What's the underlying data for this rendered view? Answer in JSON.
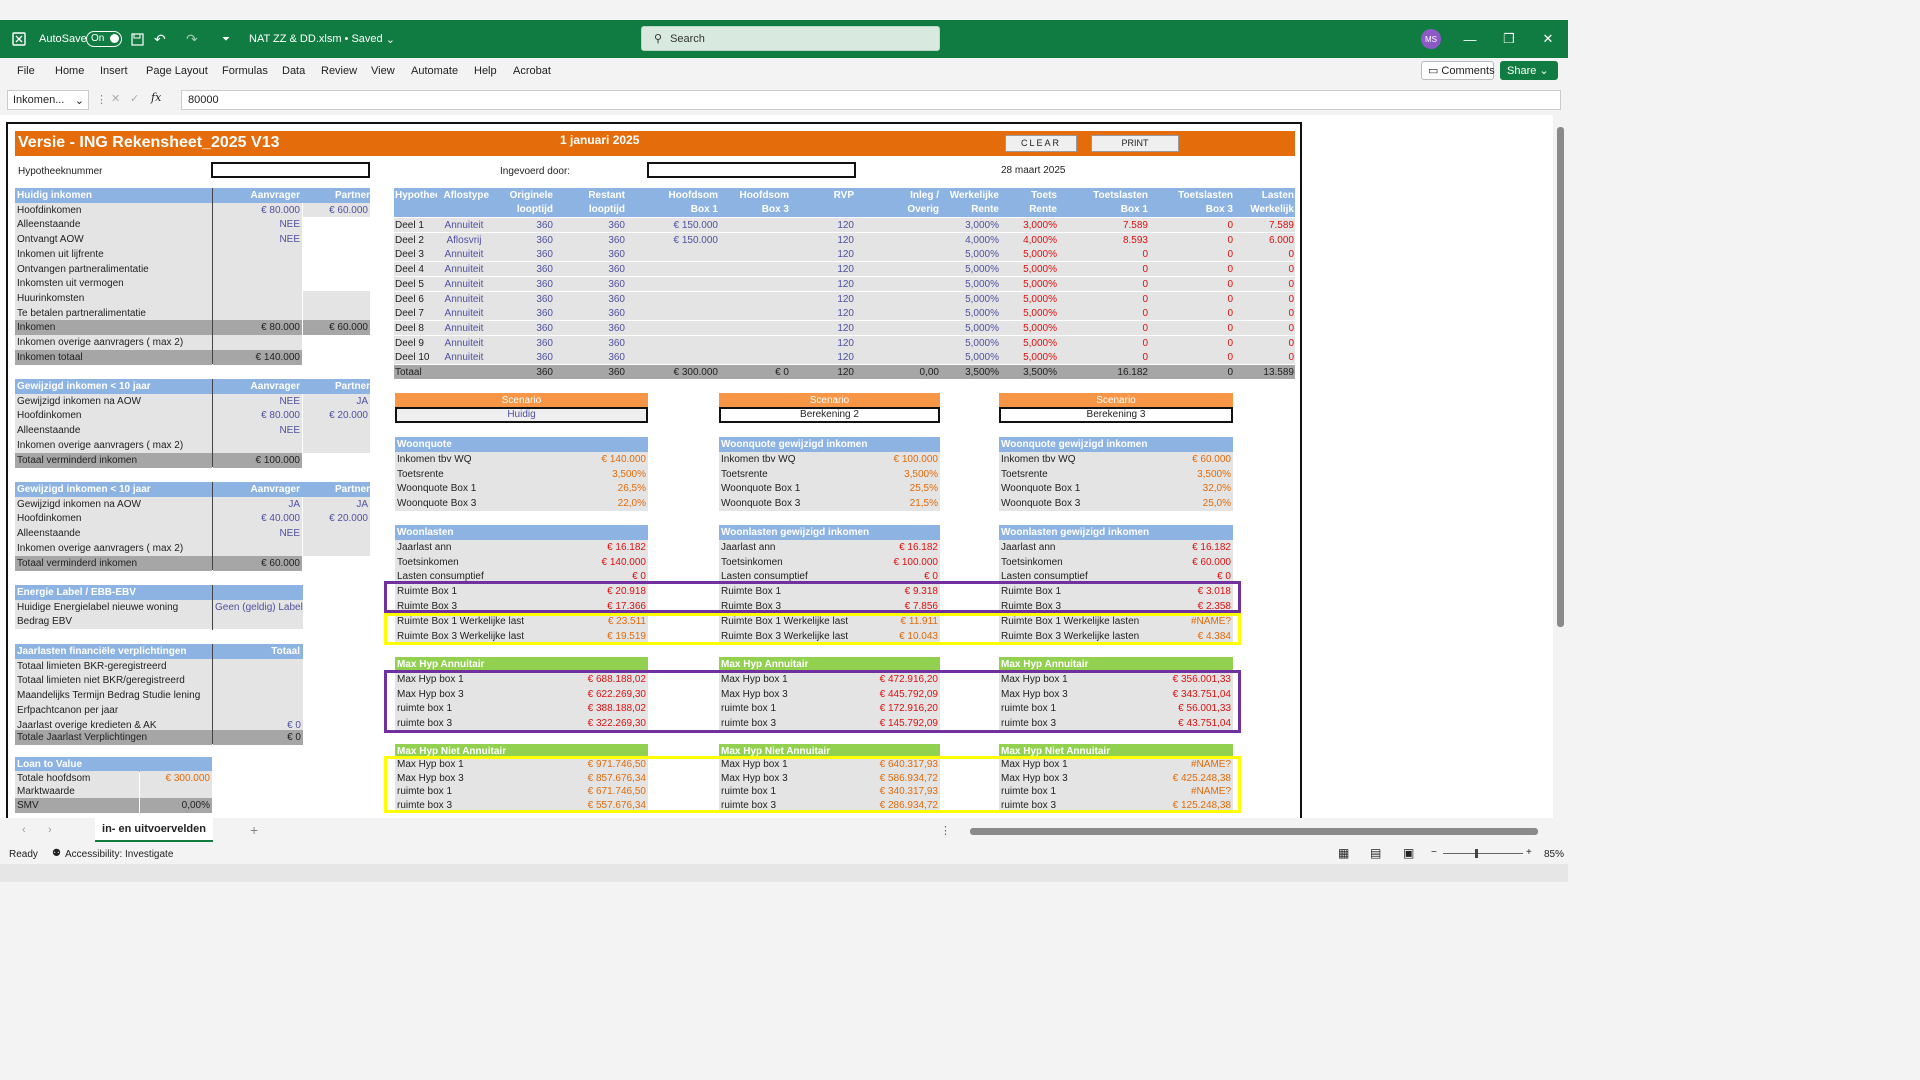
{
  "app": {
    "autosave": "AutoSave",
    "autosave_state": "On",
    "filename": "NAT ZZ & DD.xlsm",
    "saved": "• Saved",
    "search": "Search",
    "user_initials": "MS",
    "brand_color": "#107c41"
  },
  "menu": [
    "File",
    "Home",
    "Insert",
    "Page Layout",
    "Formulas",
    "Data",
    "Review",
    "View",
    "Automate",
    "Help",
    "Acrobat"
  ],
  "ribbon_right": {
    "comments": "Comments",
    "share": "Share"
  },
  "formula_bar": {
    "name_box": "Inkomen...",
    "fx": "fx",
    "value": "80000"
  },
  "header": {
    "title": "Versie - ING Rekensheet_2025 V13",
    "date": "1 januari 2025",
    "clear": "CLEAR",
    "print": "PRINT",
    "hypotheeknummer": "Hypotheeknummer",
    "ingevoerd": "Ingevoerd door:",
    "date2": "28 maart 2025",
    "accent": "#e46c0a"
  },
  "huidig": {
    "title": "Huidig inkomen",
    "col1": "Aanvrager",
    "col2": "Partner",
    "rows": [
      [
        "Hoofdinkomen",
        "€ 80.000",
        "€ 60.000"
      ],
      [
        "Alleenstaande",
        "NEE",
        ""
      ],
      [
        "Ontvangt AOW",
        "NEE",
        ""
      ],
      [
        "Inkomen uit lijfrente",
        "",
        ""
      ],
      [
        "Ontvangen partneralimentatie",
        "",
        ""
      ],
      [
        "Inkomsten uit vermogen",
        "",
        ""
      ],
      [
        "Huurinkomsten",
        "",
        ""
      ],
      [
        "Te betalen partneralimentatie",
        "",
        ""
      ]
    ],
    "inkomen": [
      "Inkomen",
      "€ 80.000",
      "€ 60.000"
    ],
    "overige": "Inkomen overige aanvragers ( max 2)",
    "totaal": [
      "Inkomen totaal",
      "€ 140.000"
    ]
  },
  "gew1": {
    "title": "Gewijzigd inkomen < 10 jaar",
    "col1": "Aanvrager",
    "col2": "Partner",
    "rows": [
      [
        "Gewijzigd inkomen na AOW",
        "NEE",
        "JA"
      ],
      [
        "Hoofdinkomen",
        "€ 80.000",
        "€ 20.000"
      ],
      [
        "Alleenstaande",
        "NEE",
        ""
      ],
      [
        "Inkomen overige aanvragers ( max 2)",
        "",
        ""
      ]
    ],
    "totaal": [
      "Totaal verminderd inkomen",
      "€ 100.000"
    ]
  },
  "gew2": {
    "title": "Gewijzigd inkomen < 10 jaar",
    "col1": "Aanvrager",
    "col2": "Partner",
    "rows": [
      [
        "Gewijzigd inkomen na AOW",
        "JA",
        "JA"
      ],
      [
        "Hoofdinkomen",
        "€ 40.000",
        "€ 20.000"
      ],
      [
        "Alleenstaande",
        "NEE",
        ""
      ],
      [
        "Inkomen overige aanvragers ( max 2)",
        "",
        ""
      ]
    ],
    "totaal": [
      "Totaal verminderd inkomen",
      "€ 60.000"
    ]
  },
  "energie": {
    "title": "Energie Label / EBB-EBV",
    "rows": [
      [
        "Huidige Energielabel  nieuwe woning",
        "Geen (geldig) Label"
      ],
      [
        "Bedrag EBV",
        ""
      ]
    ]
  },
  "jaarlasten": {
    "title": "Jaarlasten financiële verplichtingen",
    "col": "Totaal",
    "rows": [
      [
        "Totaal limieten BKR-geregistreerd",
        ""
      ],
      [
        "Totaal limieten niet BKR/geregistreerd",
        ""
      ],
      [
        "Maandelijks Termijn Bedrag Studie lening",
        ""
      ],
      [
        "Erfpachtcanon per jaar",
        ""
      ],
      [
        "Jaarlast overige kredieten & AK",
        "€ 0"
      ]
    ],
    "totaal": [
      "Totale Jaarlast Verplichtingen",
      "€ 0"
    ]
  },
  "ltv": {
    "title": "Loan to Value",
    "rows": [
      [
        "Totale hoofdsom",
        "€ 300.000"
      ],
      [
        "Marktwaarde",
        ""
      ],
      [
        "SMV",
        "0,00%"
      ]
    ]
  },
  "loans": {
    "headers1": [
      "Hypothec",
      "Aflostype",
      "Originele",
      "Restant",
      "Hoofdsom",
      "Hoofdsom",
      "RVP",
      "Inleg /",
      "Werkelijke",
      "Toets",
      "Toetslasten",
      "Toetslasten",
      "Lasten"
    ],
    "headers2": [
      "",
      "",
      "looptijd",
      "looptijd",
      "Box 1",
      "Box 3",
      "",
      "Overig",
      "Rente",
      "Rente",
      "Box 1",
      "Box 3",
      "Werkelijk"
    ],
    "rows": [
      [
        "Deel 1",
        "Annuiteit",
        "360",
        "360",
        "€ 150.000",
        "",
        "120",
        "",
        "3,000%",
        "3,000%",
        "7.589",
        "0",
        "7.589"
      ],
      [
        "Deel 2",
        "Aflosvrij",
        "360",
        "360",
        "€ 150.000",
        "",
        "120",
        "",
        "4,000%",
        "4,000%",
        "8.593",
        "0",
        "6.000"
      ],
      [
        "Deel 3",
        "Annuiteit",
        "360",
        "360",
        "",
        "",
        "120",
        "",
        "5,000%",
        "5,000%",
        "0",
        "0",
        "0"
      ],
      [
        "Deel 4",
        "Annuiteit",
        "360",
        "360",
        "",
        "",
        "120",
        "",
        "5,000%",
        "5,000%",
        "0",
        "0",
        "0"
      ],
      [
        "Deel 5",
        "Annuiteit",
        "360",
        "360",
        "",
        "",
        "120",
        "",
        "5,000%",
        "5,000%",
        "0",
        "0",
        "0"
      ],
      [
        "Deel 6",
        "Annuiteit",
        "360",
        "360",
        "",
        "",
        "120",
        "",
        "5,000%",
        "5,000%",
        "0",
        "0",
        "0"
      ],
      [
        "Deel 7",
        "Annuiteit",
        "360",
        "360",
        "",
        "",
        "120",
        "",
        "5,000%",
        "5,000%",
        "0",
        "0",
        "0"
      ],
      [
        "Deel 8",
        "Annuiteit",
        "360",
        "360",
        "",
        "",
        "120",
        "",
        "5,000%",
        "5,000%",
        "0",
        "0",
        "0"
      ],
      [
        "Deel 9",
        "Annuiteit",
        "360",
        "360",
        "",
        "",
        "120",
        "",
        "5,000%",
        "5,000%",
        "0",
        "0",
        "0"
      ],
      [
        "Deel 10",
        "Annuiteit",
        "360",
        "360",
        "",
        "",
        "120",
        "",
        "5,000%",
        "5,000%",
        "0",
        "0",
        "0"
      ]
    ],
    "totaal": [
      "Totaal",
      "",
      "360",
      "360",
      "€ 300.000",
      "€ 0",
      "120",
      "0,00",
      "3,500%",
      "3,500%",
      "16.182",
      "0",
      "13.589"
    ]
  },
  "scenarios": [
    {
      "label": "Scenario",
      "name": "Huidig",
      "wq_title": "Woonquote",
      "wq": [
        [
          "Inkomen tbv WQ",
          "€ 140.000"
        ],
        [
          "Toetsrente",
          "3,500%"
        ],
        [
          "Woonquote Box 1",
          "26,5%"
        ],
        [
          "Woonquote Box 3",
          "22,0%"
        ]
      ],
      "wl_title": "Woonlasten",
      "wl": [
        [
          "Jaarlast ann",
          "€ 16.182"
        ],
        [
          "Toetsinkomen",
          "€ 140.000"
        ],
        [
          "Lasten consumptief",
          "€ 0"
        ]
      ],
      "ruimte": [
        [
          "Ruimte Box 1",
          "€ 20.918"
        ],
        [
          "Ruimte Box 3",
          "€ 17.366"
        ]
      ],
      "werk": [
        [
          "Ruimte Box 1 Werkelijke last",
          "€ 23.511"
        ],
        [
          "Ruimte Box 3 Werkelijke last",
          "€ 19.519"
        ]
      ],
      "ma_title": "Max Hyp Annuitair",
      "ma": [
        [
          "Max Hyp box 1",
          "€ 688.188,02"
        ],
        [
          "Max Hyp box 3",
          "€ 622.269,30"
        ],
        [
          "ruimte box 1",
          "€ 388.188,02"
        ],
        [
          "ruimte box 3",
          "€ 322.269,30"
        ]
      ],
      "mn_title": "Max Hyp Niet Annuitair",
      "mn": [
        [
          "Max Hyp box 1",
          "€ 971.746,50"
        ],
        [
          "Max Hyp box 3",
          "€ 857.676,34"
        ],
        [
          "ruimte box 1",
          "€ 671.746,50"
        ],
        [
          "ruimte box 3",
          "€ 557.676,34"
        ]
      ]
    },
    {
      "label": "Scenario",
      "name": "Berekening 2",
      "wq_title": "Woonquote gewijzigd inkomen",
      "wq": [
        [
          "Inkomen tbv WQ",
          "€ 100.000"
        ],
        [
          "Toetsrente",
          "3,500%"
        ],
        [
          "Woonquote Box 1",
          "25,5%"
        ],
        [
          "Woonquote Box 3",
          "21,5%"
        ]
      ],
      "wl_title": "Woonlasten gewijzigd inkomen",
      "wl": [
        [
          "Jaarlast ann",
          "€ 16.182"
        ],
        [
          "Toetsinkomen",
          "€ 100.000"
        ],
        [
          "Lasten consumptief",
          "€ 0"
        ]
      ],
      "ruimte": [
        [
          "Ruimte Box 1",
          "€ 9.318"
        ],
        [
          "Ruimte Box 3",
          "€ 7.856"
        ]
      ],
      "werk": [
        [
          "Ruimte Box 1 Werkelijke last",
          "€ 11.911"
        ],
        [
          "Ruimte Box 3 Werkelijke last",
          "€ 10.043"
        ]
      ],
      "ma_title": "Max Hyp Annuitair",
      "ma": [
        [
          "Max Hyp box 1",
          "€ 472.916,20"
        ],
        [
          "Max Hyp box 3",
          "€ 445.792,09"
        ],
        [
          "ruimte box 1",
          "€ 172.916,20"
        ],
        [
          "ruimte box 3",
          "€ 145.792,09"
        ]
      ],
      "mn_title": "Max Hyp Niet Annuitair",
      "mn": [
        [
          "Max Hyp box 1",
          "€ 640.317,93"
        ],
        [
          "Max Hyp box 3",
          "€ 586.934,72"
        ],
        [
          "ruimte box 1",
          "€ 340.317,93"
        ],
        [
          "ruimte box 3",
          "€ 286.934,72"
        ]
      ]
    },
    {
      "label": "Scenario",
      "name": "Berekening 3",
      "wq_title": "Woonquote gewijzigd inkomen",
      "wq": [
        [
          "Inkomen tbv WQ",
          "€ 60.000"
        ],
        [
          "Toetsrente",
          "3,500%"
        ],
        [
          "Woonquote Box 1",
          "32,0%"
        ],
        [
          "Woonquote Box 3",
          "25,0%"
        ]
      ],
      "wl_title": "Woonlasten gewijzigd inkomen",
      "wl": [
        [
          "Jaarlast ann",
          "€ 16.182"
        ],
        [
          "Toetsinkomen",
          "€ 60.000"
        ],
        [
          "Lasten consumptief",
          "€ 0"
        ]
      ],
      "ruimte": [
        [
          "Ruimte Box 1",
          "€ 3.018"
        ],
        [
          "Ruimte Box 3",
          "€ 2.358"
        ]
      ],
      "werk": [
        [
          "Ruimte Box 1 Werkelijke lasten",
          "#NAME?"
        ],
        [
          "Ruimte Box 3 Werkelijke lasten",
          "€ 4.384"
        ]
      ],
      "ma_title": "Max Hyp Annuitair",
      "ma": [
        [
          "Max Hyp box 1",
          "€ 356.001,33"
        ],
        [
          "Max Hyp box 3",
          "€ 343.751,04"
        ],
        [
          "ruimte box 1",
          "€ 56.001,33"
        ],
        [
          "ruimte box 3",
          "€ 43.751,04"
        ]
      ],
      "mn_title": "Max Hyp Niet Annuitair",
      "mn": [
        [
          "Max Hyp box 1",
          "#NAME?"
        ],
        [
          "Max Hyp box 3",
          "€ 425.248,38"
        ],
        [
          "ruimte box 1",
          "#NAME?"
        ],
        [
          "ruimte box 3",
          "€ 125.248,38"
        ]
      ]
    }
  ],
  "sheet_tab": "in- en uitvoervelden",
  "status": {
    "ready": "Ready",
    "accessibility": "Accessibility: Investigate",
    "zoom": "85%"
  }
}
